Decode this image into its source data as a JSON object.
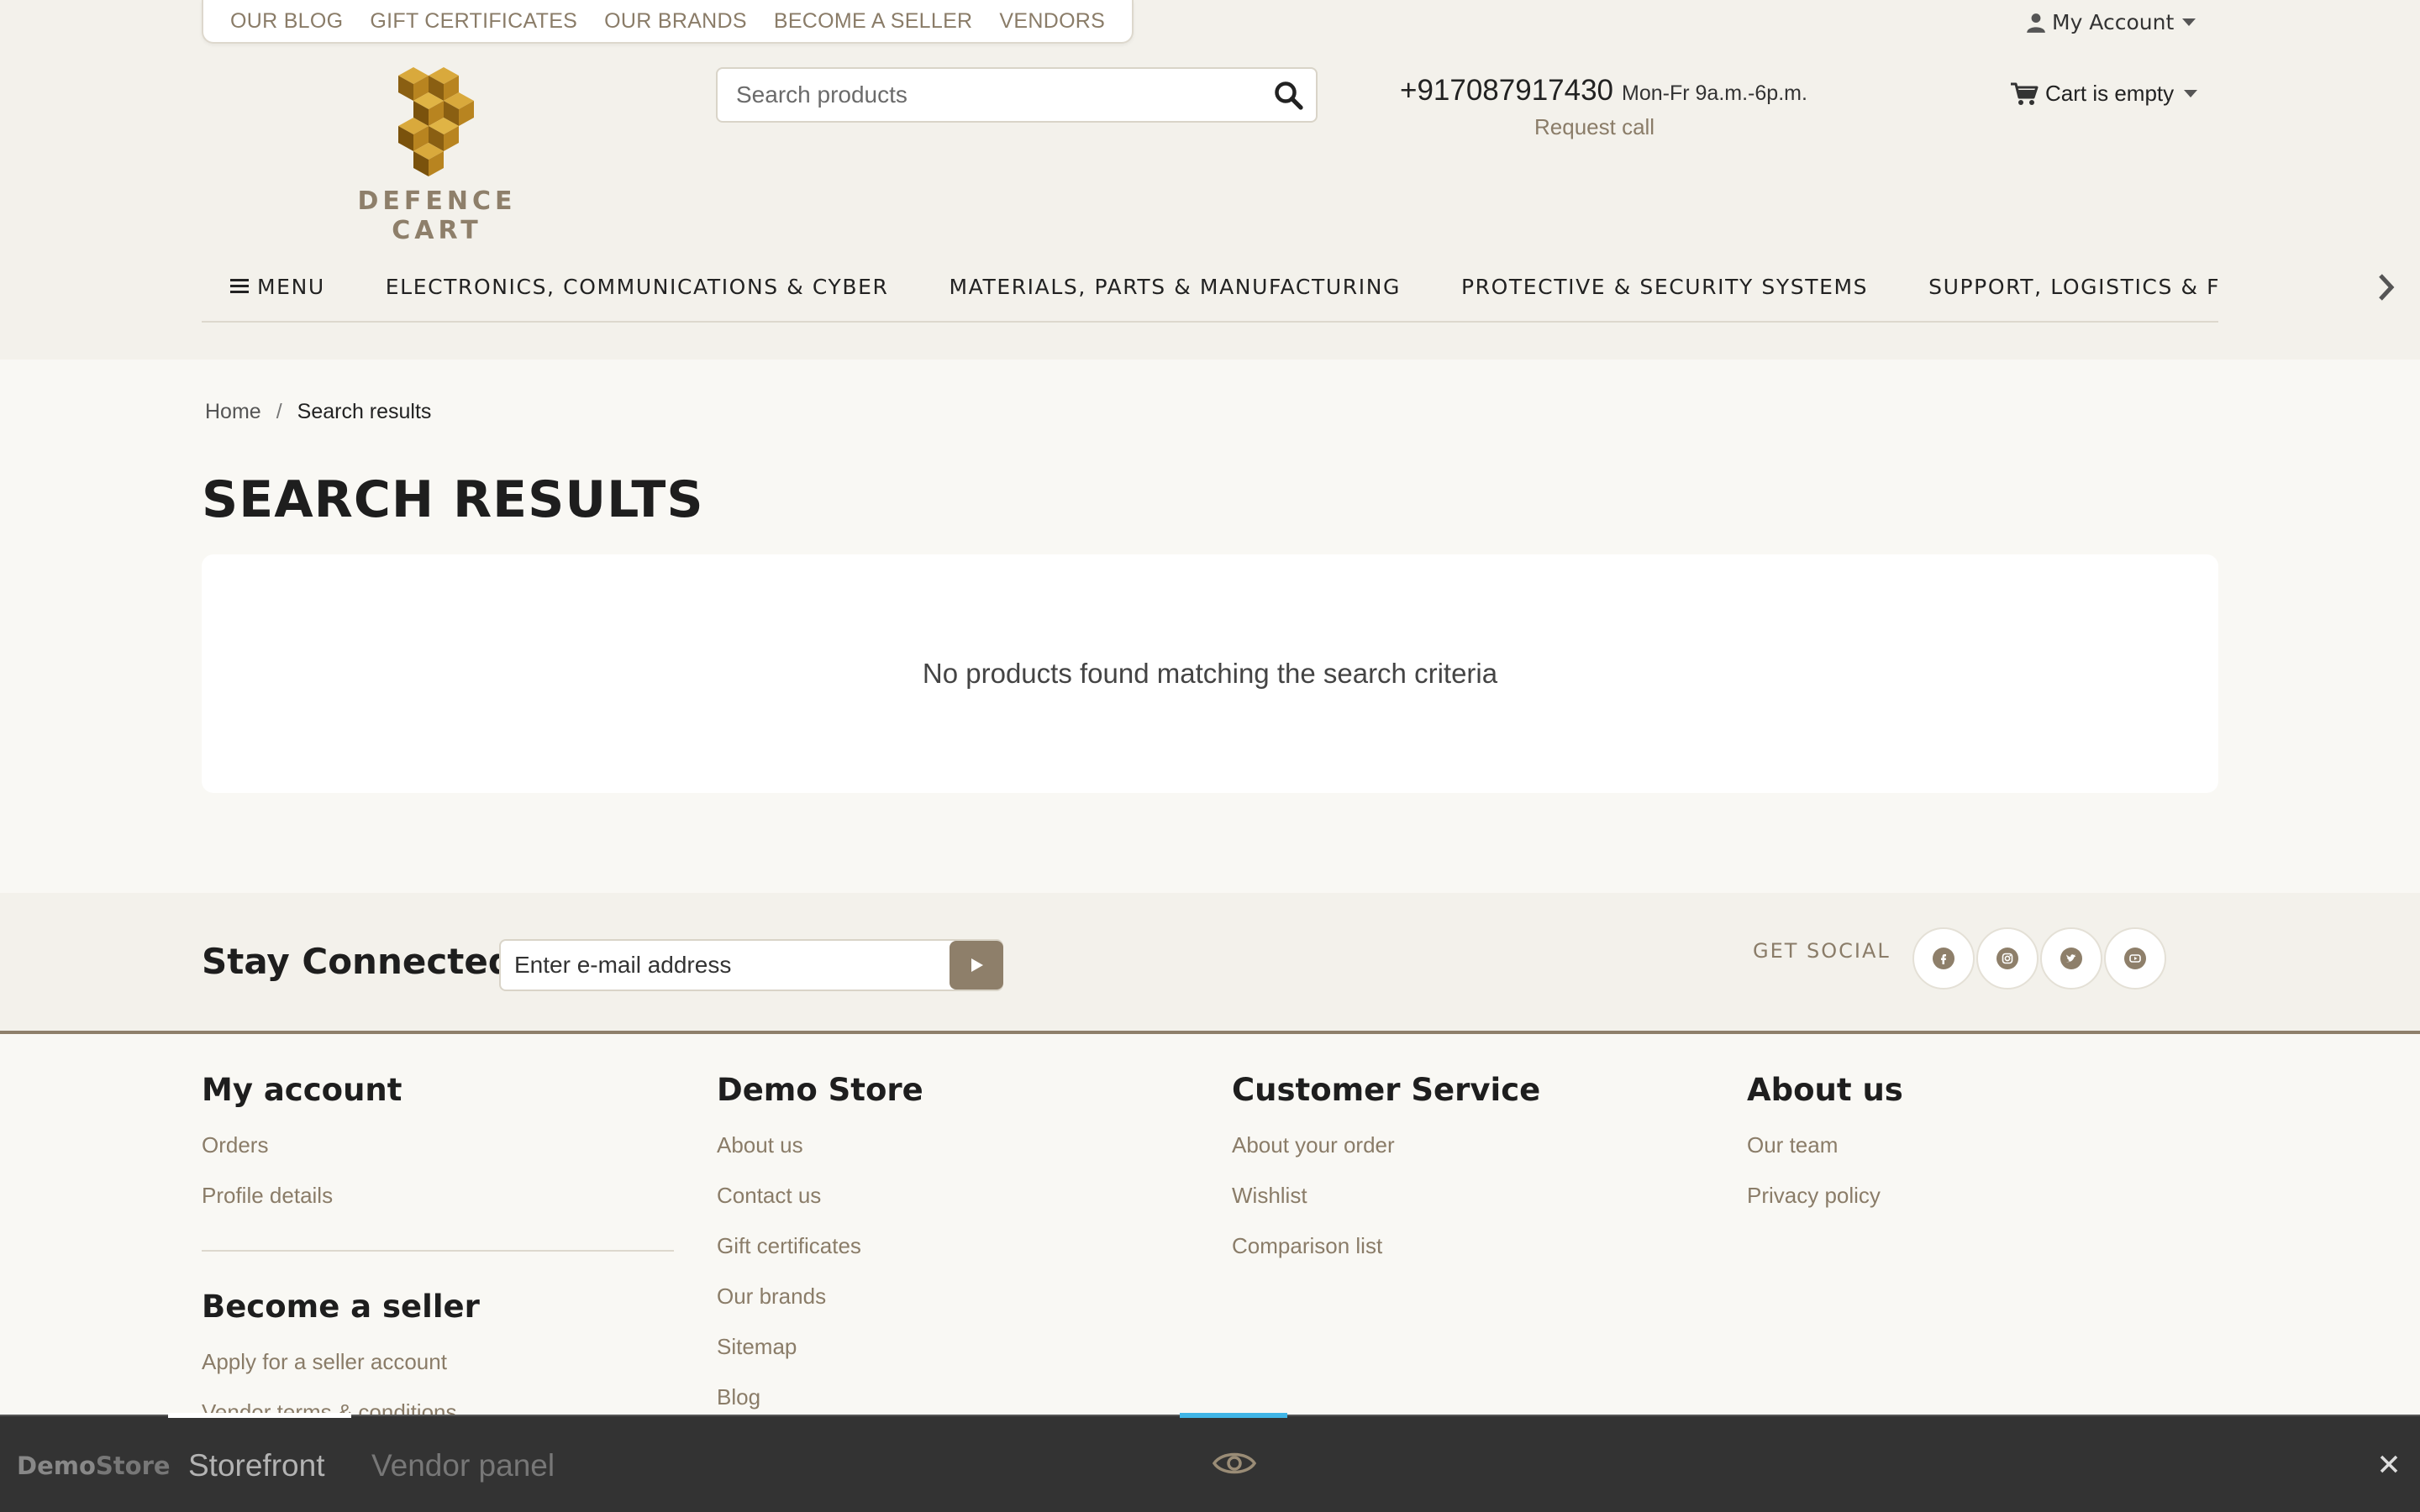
{
  "top_links": [
    "OUR BLOG",
    "GIFT CERTIFICATES",
    "OUR BRANDS",
    "BECOME A SELLER",
    "VENDORS"
  ],
  "account": {
    "label": "My Account"
  },
  "logo": {
    "text": "DEFENCE CART"
  },
  "search": {
    "placeholder": "Search products"
  },
  "contact": {
    "phone": "+917087917430",
    "hours": "Mon-Fr 9a.m.-6p.m.",
    "request_call": "Request call"
  },
  "cart": {
    "label": "Cart is empty"
  },
  "nav": {
    "menu": "MENU",
    "items": [
      "ELECTRONICS, COMMUNICATIONS & CYBER",
      "MATERIALS, PARTS & MANUFACTURING",
      "PROTECTIVE & SECURITY SYSTEMS",
      "SUPPORT, LOGISTICS & FIE"
    ]
  },
  "breadcrumb": {
    "home": "Home",
    "sep": "/",
    "current": "Search results"
  },
  "page_title": "SEARCH RESULTS",
  "results": {
    "empty_message": "No products found matching the search criteria"
  },
  "newsletter": {
    "title": "Stay Connected",
    "placeholder": "Enter e-mail address"
  },
  "social": {
    "label": "GET SOCIAL",
    "icons": [
      "facebook-icon",
      "instagram-icon",
      "twitter-icon",
      "youtube-icon"
    ]
  },
  "footer": {
    "my_account": {
      "title": "My account",
      "links": [
        "Orders",
        "Profile details"
      ]
    },
    "become_seller": {
      "title": "Become a seller",
      "links": [
        "Apply for a seller account",
        "Vendor terms & conditions"
      ]
    },
    "demo_store": {
      "title": "Demo Store",
      "links": [
        "About us",
        "Contact us",
        "Gift certificates",
        "Our brands",
        "Sitemap",
        "Blog"
      ]
    },
    "customer_service": {
      "title": "Customer Service",
      "links": [
        "About your order",
        "Wishlist",
        "Comparison list"
      ]
    },
    "about_us": {
      "title": "About us",
      "links": [
        "Our team",
        "Privacy policy"
      ]
    }
  },
  "bottom_bar": {
    "logo_a": "Demo",
    "logo_b": "Store",
    "tab_storefront": "Storefront",
    "tab_vendor": "Vendor panel"
  },
  "colors": {
    "accent": "#8e7f6a",
    "header_bg": "#f3f1eb",
    "page_bg": "#f9f8f4",
    "bottom_bar": "#333333",
    "indicator": "#40b5e6"
  }
}
